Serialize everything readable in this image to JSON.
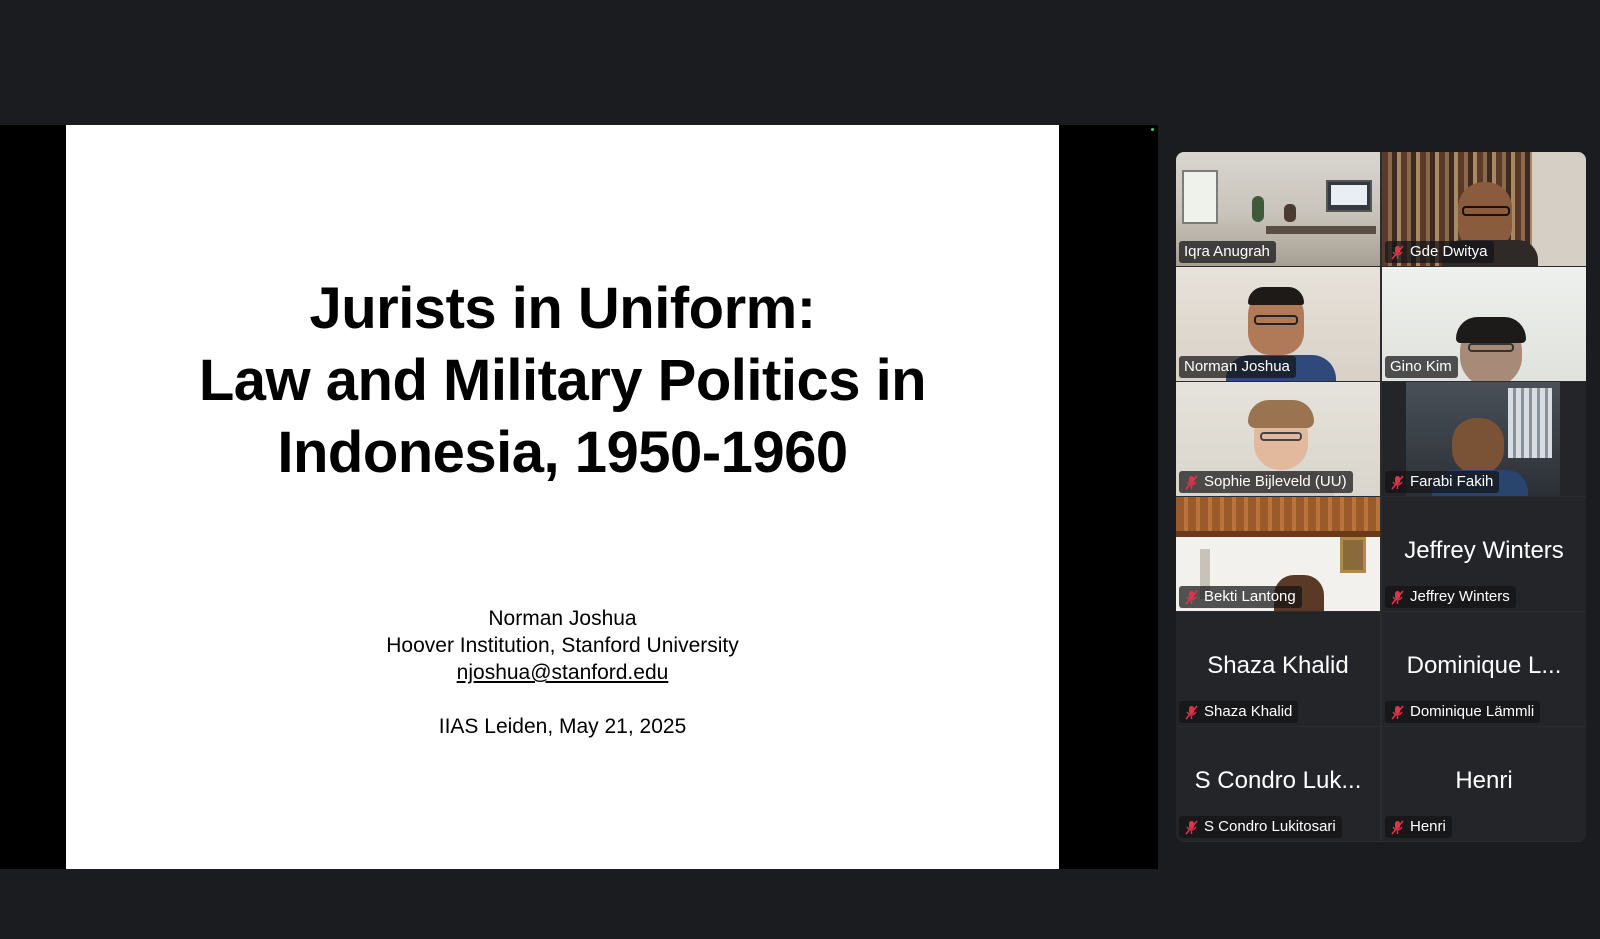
{
  "slide": {
    "title_lines": [
      "Jurists in Uniform:",
      "Law and Military Politics in",
      "Indonesia, 1950-1960"
    ],
    "author": "Norman Joshua",
    "affiliation": "Hoover Institution, Stanford University",
    "email": "njoshua@stanford.edu",
    "venue_date": "IIAS Leiden, May 21, 2025"
  },
  "participants": [
    {
      "name": "Iqra Anugrah",
      "muted": false,
      "video": true,
      "active": false
    },
    {
      "name": "Gde Dwitya",
      "muted": true,
      "video": true,
      "active": false
    },
    {
      "name": "Norman Joshua",
      "muted": false,
      "video": true,
      "active": true
    },
    {
      "name": "Gino Kim",
      "muted": false,
      "video": true,
      "active": false
    },
    {
      "name": "Sophie Bijleveld (UU)",
      "muted": true,
      "video": true,
      "active": false
    },
    {
      "name": "Farabi Fakih",
      "muted": true,
      "video": true,
      "active": false
    },
    {
      "name": "Bekti Lantong",
      "muted": true,
      "video": true,
      "active": false
    },
    {
      "name": "Jeffrey Winters",
      "display_name": "Jeffrey Winters",
      "muted": true,
      "video": false,
      "active": false
    },
    {
      "name": "Shaza Khalid",
      "display_name": "Shaza Khalid",
      "muted": true,
      "video": false,
      "active": false
    },
    {
      "name": "Dominique Lämmli",
      "display_name": "Dominique L...",
      "muted": true,
      "video": false,
      "active": false
    },
    {
      "name": "S Condro Lukitosari",
      "display_name": "S Condro Luk...",
      "muted": true,
      "video": false,
      "active": false
    },
    {
      "name": "Henri",
      "display_name": "Henri",
      "muted": true,
      "video": false,
      "active": false
    }
  ],
  "colors": {
    "background": "#1b1c20",
    "gallery": "#2b2c30",
    "active_speaker": "#39c24a",
    "muted_icon": "#e0334a"
  }
}
